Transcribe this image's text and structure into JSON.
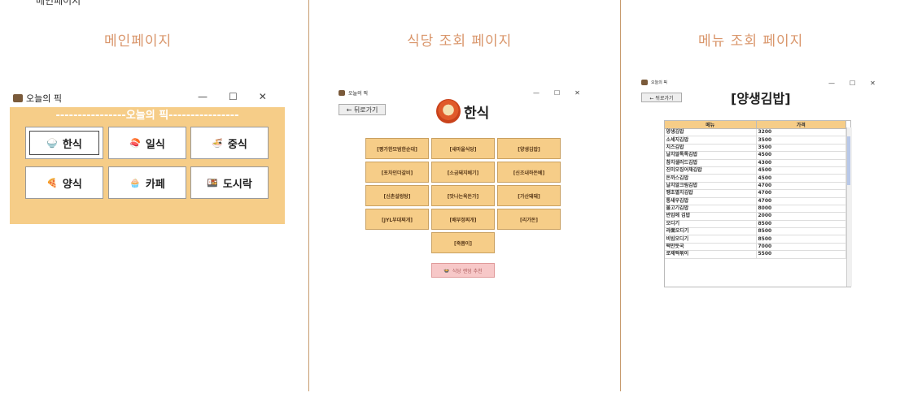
{
  "top_caption": "메인페이지",
  "columns": {
    "main": "메인페이지",
    "restaurant": "식당 조회 페이지",
    "menu": "메뉴 조회 페이지"
  },
  "main_window": {
    "title": "오늘의 픽",
    "header": "----------------오늘의 픽----------------",
    "controls": [
      "—",
      "☐",
      "✕"
    ],
    "categories": [
      {
        "label": "한식",
        "icon": "rice-bowl-icon"
      },
      {
        "label": "일식",
        "icon": "sushi-icon"
      },
      {
        "label": "중식",
        "icon": "noodle-bowl-icon"
      },
      {
        "label": "양식",
        "icon": "pizza-icon"
      },
      {
        "label": "카페",
        "icon": "cupcake-icon"
      },
      {
        "label": "도시락",
        "icon": "lunchbox-icon"
      }
    ]
  },
  "restaurant_window": {
    "title": "오늘의 픽",
    "back": "← 뒤로가기",
    "heading": "한식",
    "controls": [
      "—",
      "☐",
      "✕"
    ],
    "restaurants": [
      "[평가한모범한순대]",
      "[새마을식당]",
      "[양생김밥]",
      "[포차인더갈비]",
      "[소금돼지베기]",
      "[신조내하돈베]",
      "[신촌설렁탕]",
      "[맛나는육돈가]",
      "[가산돼돼]",
      "[JYL부대찌개]",
      "[배부정찌개]",
      "[리가돈]",
      "[죽쯤이]"
    ],
    "recommend": "식당 랜덤 추천"
  },
  "menu_window": {
    "title": "오늘의 픽",
    "back": "← 뒤로가기",
    "heading": "[양생김밥]",
    "controls": [
      "—",
      "☐",
      "✕"
    ],
    "columns": [
      "메뉴",
      "가격"
    ],
    "rows": [
      [
        "양생김밥",
        "3200"
      ],
      [
        "소세지김밥",
        "3500"
      ],
      [
        "치즈김밥",
        "3500"
      ],
      [
        "날치알톡톡김밥",
        "4500"
      ],
      [
        "참치샐러드김밥",
        "4300"
      ],
      [
        "진미오징어채김밥",
        "4500"
      ],
      [
        "돈까스김밥",
        "4500"
      ],
      [
        "날치알크림김밥",
        "4700"
      ],
      [
        "땡초멸치김밥",
        "4700"
      ],
      [
        "통새우김밥",
        "4700"
      ],
      [
        "불고기김밥",
        "8000"
      ],
      [
        "반입에 김밥",
        "2000"
      ],
      [
        "오디기",
        "8500"
      ],
      [
        "라面오디기",
        "8500"
      ],
      [
        "비빔오디기",
        "8500"
      ],
      [
        "떡만둣국",
        "7000"
      ],
      [
        "로제떡볶이",
        "5500"
      ]
    ]
  }
}
